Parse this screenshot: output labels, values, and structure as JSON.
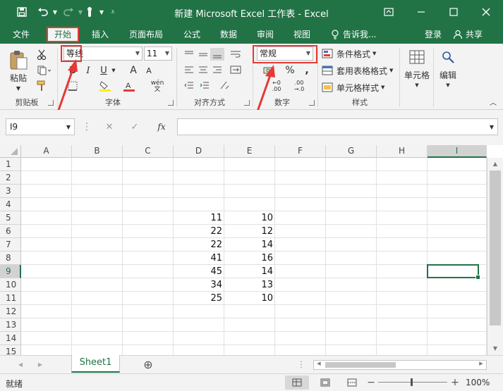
{
  "titlebar": {
    "title": "新建 Microsoft Excel 工作表 - Excel",
    "save_icon": "save-icon",
    "undo_icon": "undo-icon",
    "redo_icon": "redo-icon",
    "touch_icon": "touch-mode-icon",
    "customize_icon": "customize-toolbar-icon",
    "ribbon_display_icon": "ribbon-display-icon",
    "minimize_icon": "minimize-icon",
    "maximize_icon": "maximize-icon",
    "close_icon": "close-icon"
  },
  "tabs": {
    "file": "文件",
    "home": "开始",
    "insert": "插入",
    "page_layout": "页面布局",
    "formulas": "公式",
    "data": "数据",
    "review": "审阅",
    "view": "视图",
    "tell_me": "告诉我...",
    "signin": "登录",
    "share": "共享"
  },
  "ribbon": {
    "clipboard": {
      "label": "剪贴板",
      "paste": "粘贴"
    },
    "font": {
      "label": "字体",
      "font_name": "等线",
      "font_size": "11",
      "bold": "B",
      "italic": "I",
      "underline": "U",
      "grow": "A",
      "shrink": "A",
      "wen": "wén"
    },
    "alignment": {
      "label": "对齐方式"
    },
    "number": {
      "label": "数字",
      "format": "常规",
      "percent": "%",
      "comma": ","
    },
    "styles": {
      "label": "样式",
      "conditional": "条件格式",
      "table": "套用表格格式",
      "cell_styles": "单元格样式"
    },
    "cells": {
      "label": "单元格"
    },
    "editing": {
      "label": "编辑"
    }
  },
  "formula_bar": {
    "name_box": "I9",
    "cancel": "✕",
    "enter": "✓",
    "fx": "fx",
    "value": ""
  },
  "grid": {
    "columns": [
      "A",
      "B",
      "C",
      "D",
      "E",
      "F",
      "G",
      "H",
      "I"
    ],
    "rows": [
      "1",
      "2",
      "3",
      "4",
      "5",
      "6",
      "7",
      "8",
      "9",
      "10",
      "11",
      "12",
      "13",
      "14",
      "15"
    ],
    "selected_cell": "I9",
    "cells": [
      {
        "ref": "D5",
        "value": "11"
      },
      {
        "ref": "E5",
        "value": "10"
      },
      {
        "ref": "D6",
        "value": "22"
      },
      {
        "ref": "E6",
        "value": "12"
      },
      {
        "ref": "D7",
        "value": "22"
      },
      {
        "ref": "E7",
        "value": "14"
      },
      {
        "ref": "D8",
        "value": "41"
      },
      {
        "ref": "E8",
        "value": "16"
      },
      {
        "ref": "D9",
        "value": "45"
      },
      {
        "ref": "E9",
        "value": "14"
      },
      {
        "ref": "D10",
        "value": "34"
      },
      {
        "ref": "E10",
        "value": "13"
      },
      {
        "ref": "D11",
        "value": "25"
      },
      {
        "ref": "E11",
        "value": "10"
      }
    ]
  },
  "sheets": {
    "active": "Sheet1",
    "add": "⊕"
  },
  "status": {
    "ready": "就绪",
    "zoom": "100%"
  },
  "colors": {
    "accent": "#217346",
    "highlight": "#e53935"
  }
}
